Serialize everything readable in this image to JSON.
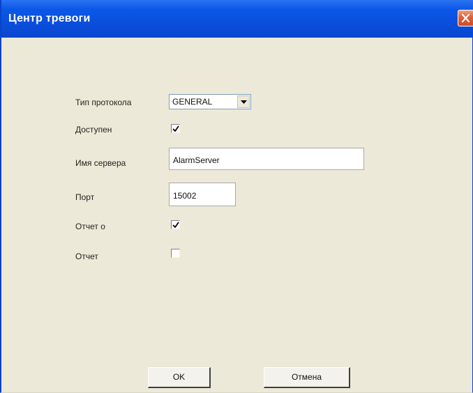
{
  "window": {
    "title": "Центр тревоги"
  },
  "form": {
    "protocol_label": "Тип протокола",
    "protocol_value": "GENERAL",
    "enabled_label": "Доступен",
    "enabled_checked": true,
    "server_name_label": "Имя сервера",
    "server_name_value": "AlarmServer",
    "port_label": "Порт",
    "port_value": "15002",
    "report_label": "Отчет о",
    "report_checked": true,
    "report2_label": "Отчет",
    "report2_checked": false
  },
  "buttons": {
    "ok_label": "OK",
    "cancel_label": "Отмена"
  },
  "icons": {
    "close": "close-icon",
    "dropdown": "chevron-down-icon",
    "check": "checkmark-icon"
  },
  "colors": {
    "titlebar": "#0a4fdc",
    "close_button": "#e2643c",
    "dialog_background": "#ece9d8"
  }
}
